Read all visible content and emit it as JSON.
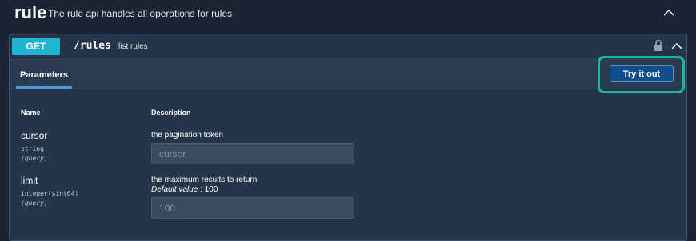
{
  "tag": {
    "name": "rule",
    "description": "The rule api handles all operations for rules"
  },
  "operation": {
    "method": "GET",
    "path": "/rules",
    "summary": "list rules",
    "tab_label": "Parameters",
    "try_button": "Try it out"
  },
  "params_table": {
    "col_name": "Name",
    "col_description": "Description",
    "rows": [
      {
        "name": "cursor",
        "type": "string",
        "in": "(query)",
        "description": "the pagination token",
        "placeholder": "cursor"
      },
      {
        "name": "limit",
        "type": "integer($int64)",
        "in": "(query)",
        "description": "the maximum results to return",
        "default_label": "Default value",
        "default_sep": " : 100",
        "placeholder": "100"
      }
    ]
  },
  "icons": {
    "tag_toggle": "chevron-up-icon",
    "lock": "lock-icon",
    "op_toggle": "chevron-up-icon"
  },
  "colors": {
    "background": "#1b2433",
    "get_method": "#20b4d0",
    "try_button": "#0f4d8c",
    "highlight_border": "#19b6a2"
  }
}
